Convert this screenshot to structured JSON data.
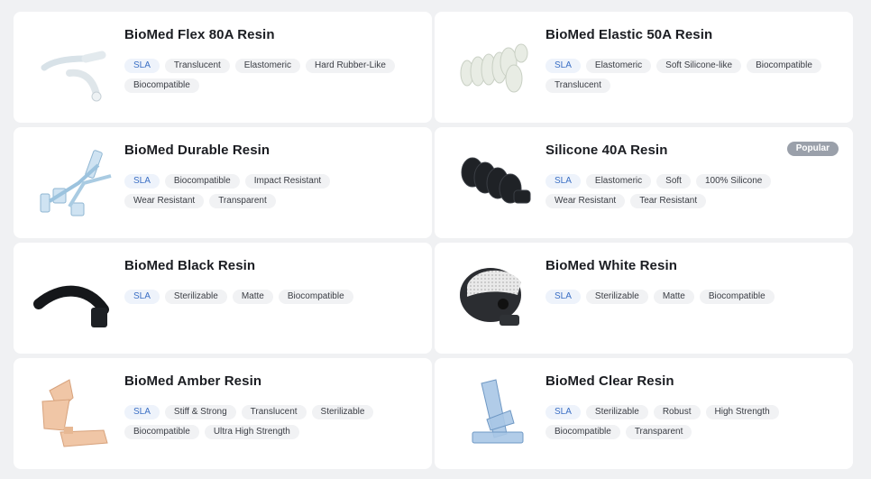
{
  "badge": "Popular",
  "products": [
    {
      "name": "BioMed Flex 80A Resin",
      "tags": [
        "SLA",
        "Translucent",
        "Elastomeric",
        "Hard Rubber-Like",
        "Biocompatible"
      ],
      "image": "flex-tubing-icon"
    },
    {
      "name": "BioMed Elastic 50A Resin",
      "tags": [
        "SLA",
        "Elastomeric",
        "Soft Silicone-like",
        "Biocompatible",
        "Translucent"
      ],
      "image": "elastic-bellows-icon"
    },
    {
      "name": "BioMed Durable Resin",
      "tags": [
        "SLA",
        "Biocompatible",
        "Impact Resistant",
        "Wear Resistant",
        "Transparent"
      ],
      "image": "durable-connector-icon"
    },
    {
      "name": "Silicone 40A Resin",
      "tags": [
        "SLA",
        "Elastomeric",
        "Soft",
        "100% Silicone",
        "Wear Resistant",
        "Tear Resistant"
      ],
      "image": "silicone-bellows-icon"
    },
    {
      "name": "BioMed Black Resin",
      "tags": [
        "SLA",
        "Sterilizable",
        "Matte",
        "Biocompatible"
      ],
      "image": "black-curved-part-icon"
    },
    {
      "name": "BioMed White Resin",
      "tags": [
        "SLA",
        "Sterilizable",
        "Matte",
        "Biocompatible"
      ],
      "image": "skull-model-icon"
    },
    {
      "name": "BioMed Amber Resin",
      "tags": [
        "SLA",
        "Stiff & Strong",
        "Translucent",
        "Sterilizable",
        "Biocompatible",
        "Ultra High Strength"
      ],
      "image": "amber-guide-icon"
    },
    {
      "name": "BioMed Clear Resin",
      "tags": [
        "SLA",
        "Sterilizable",
        "Robust",
        "High Strength",
        "Biocompatible",
        "Transparent"
      ],
      "image": "clear-fixture-icon"
    }
  ]
}
